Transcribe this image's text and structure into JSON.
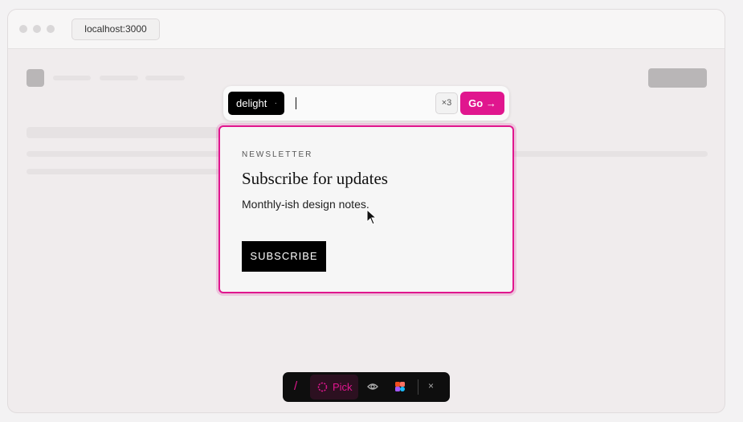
{
  "browser": {
    "url": "localhost:3000",
    "window_controls": [
      "close-dot",
      "minimize-dot",
      "maximize-dot"
    ]
  },
  "prompt_bar": {
    "mode_label": "delight",
    "mode_separator": "·",
    "input_value": "",
    "multiplier_label": "×3",
    "go_label": "Go →"
  },
  "card": {
    "eyebrow": "NEWSLETTER",
    "title": "Subscribe for updates",
    "body": "Monthly-ish design notes.",
    "button_label": "SUBSCRIBE"
  },
  "toolbar": {
    "slash_label": "/",
    "pick_label": "Pick",
    "eye_icon": "eye-icon",
    "figma_icon": "figma-icon",
    "close_label": "×"
  },
  "colors": {
    "accent": "#e0168e",
    "dark": "#0e0e0e",
    "background": "#f0eced"
  }
}
